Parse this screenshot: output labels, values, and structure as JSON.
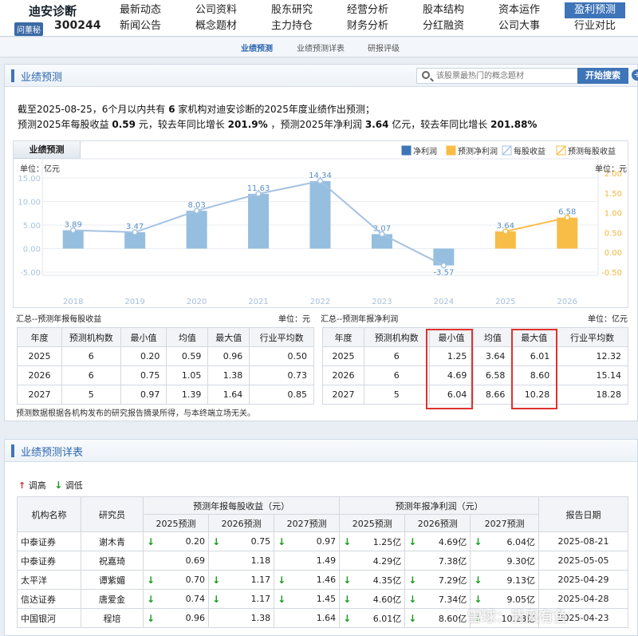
{
  "brand": {
    "name": "迪安诊断",
    "badge": "问董秘",
    "code": "300244"
  },
  "nav": [
    {
      "label": "最新动态"
    },
    {
      "label": "公司资料"
    },
    {
      "label": "股东研究"
    },
    {
      "label": "经营分析"
    },
    {
      "label": "股本结构"
    },
    {
      "label": "资本运作"
    },
    {
      "label": "盈利预测",
      "active": true
    },
    {
      "label": "新闻公告"
    },
    {
      "label": "概念题材"
    },
    {
      "label": "主力持仓"
    },
    {
      "label": "财务分析"
    },
    {
      "label": "分红融资"
    },
    {
      "label": "公司大事"
    },
    {
      "label": "行业对比"
    }
  ],
  "subnav": [
    {
      "label": "业绩预测",
      "active": true
    },
    {
      "label": "业绩预测详表"
    },
    {
      "label": "研报评级"
    }
  ],
  "panel1": {
    "title": "业绩预测",
    "search_placeholder": "该股票最热门的概念题材",
    "search_button": "开始搜索",
    "plus": "+"
  },
  "summary": {
    "line1_a": "截至2025-08-25，6个月以内共有",
    "line1_n": "6",
    "line1_b": "家机构对迪安诊断的2025年度业绩作出预测；",
    "line2_a": "预测2025年每股收益",
    "line2_eps": "0.59",
    "line2_b": "元，较去年同比增长",
    "line2_epsg": "201.9%",
    "line2_c": "，预测2025年净利润",
    "line2_np": "3.64",
    "line2_d": "亿元，较去年同比增长",
    "line2_npg": "201.88%"
  },
  "chart_tab": "业绩预测",
  "chart_data": {
    "type": "bar",
    "categories": [
      "2018",
      "2019",
      "2020",
      "2021",
      "2022",
      "2023",
      "2024",
      "2025",
      "2026"
    ],
    "left_unit": "单位：亿元",
    "right_unit": "单位：元",
    "left_ticks": [
      "15.00",
      "10.00",
      "5.00",
      "0.00",
      "-5.00"
    ],
    "right_ticks": [
      "2.00",
      "1.50",
      "1.00",
      "0.50",
      "0.00",
      "-0.50"
    ],
    "ylim_left": [
      -5,
      15
    ],
    "series": [
      {
        "name": "净利润",
        "values": [
          3.89,
          3.47,
          8.03,
          11.63,
          14.34,
          3.07,
          -3.57,
          null,
          null
        ]
      },
      {
        "name": "预测净利润",
        "values": [
          null,
          null,
          null,
          null,
          null,
          null,
          null,
          3.64,
          6.58
        ]
      }
    ],
    "value_labels": [
      "3.89",
      "3.47",
      "8.03",
      "11.63",
      "14.34",
      "3.07",
      "-3.57",
      "3.64",
      "6.58"
    ],
    "eps_lines": [
      {
        "name": "每股收益"
      },
      {
        "name": "预测每股收益"
      }
    ],
    "colors": {
      "actual": "#95bedf",
      "forecast": "#f8bd47",
      "eps_actual": "#a5c2e2",
      "eps_forecast": "#f8bd47"
    }
  },
  "left_table": {
    "caption": "汇总--预测年报每股收益",
    "unit": "单位：元",
    "headers": [
      "年度",
      "预测机构数",
      "最小值",
      "均值",
      "最大值",
      "行业平均数"
    ],
    "rows": [
      [
        "2025",
        "6",
        "0.20",
        "0.59",
        "0.96",
        "0.50"
      ],
      [
        "2026",
        "6",
        "0.75",
        "1.05",
        "1.38",
        "0.73"
      ],
      [
        "2027",
        "5",
        "0.97",
        "1.39",
        "1.64",
        "0.85"
      ]
    ]
  },
  "right_table": {
    "caption": "汇总--预测年报净利润",
    "unit": "单位：亿元",
    "headers": [
      "年度",
      "预测机构数",
      "最小值",
      "均值",
      "最大值",
      "行业平均数"
    ],
    "rows": [
      [
        "2025",
        "6",
        "1.25",
        "3.64",
        "6.01",
        "12.32"
      ],
      [
        "2026",
        "6",
        "4.69",
        "6.58",
        "8.60",
        "15.14"
      ],
      [
        "2027",
        "5",
        "6.04",
        "8.66",
        "10.28",
        "18.28"
      ]
    ]
  },
  "note": "预测数据根据各机构发布的研究报告摘录所得，与本终端立场无关。",
  "panel2": {
    "title": "业绩预测详表",
    "up_label": "调高",
    "down_label": "调低"
  },
  "detail": {
    "h_org": "机构名称",
    "h_analyst": "研究员",
    "h_eps": "预测年报每股收益（元）",
    "h_np": "预测年报净利润（元）",
    "h_date": "报告日期",
    "sub": [
      "2025预测",
      "2026预测",
      "2027预测",
      "2025预测",
      "2026预测",
      "2027预测"
    ],
    "rows": [
      {
        "org": "中泰证券",
        "analyst": "谢木青",
        "v": [
          "0.20",
          "0.75",
          "0.97",
          "1.25亿",
          "4.69亿",
          "6.04亿"
        ],
        "down": [
          true,
          true,
          true,
          true,
          true,
          true
        ],
        "date": "2025-08-21"
      },
      {
        "org": "中泰证券",
        "analyst": "祝嘉琦",
        "v": [
          "0.69",
          "1.18",
          "1.49",
          "4.29亿",
          "7.38亿",
          "9.30亿"
        ],
        "down": [
          false,
          false,
          false,
          false,
          false,
          false
        ],
        "date": "2025-05-05"
      },
      {
        "org": "太平洋",
        "analyst": "谭紫媚",
        "v": [
          "0.70",
          "1.17",
          "1.46",
          "4.35亿",
          "7.29亿",
          "9.13亿"
        ],
        "down": [
          true,
          true,
          true,
          true,
          true,
          true
        ],
        "date": "2025-04-29"
      },
      {
        "org": "信达证券",
        "analyst": "唐爱金",
        "v": [
          "0.74",
          "1.17",
          "1.45",
          "4.60亿",
          "7.34亿",
          "9.05亿"
        ],
        "down": [
          true,
          true,
          true,
          true,
          true,
          true
        ],
        "date": "2025-04-28"
      },
      {
        "org": "中国银河",
        "analyst": "程培",
        "v": [
          "0.96",
          "1.38",
          "1.64",
          "6.01亿",
          "8.60亿",
          "10.28亿"
        ],
        "down": [
          true,
          false,
          false,
          true,
          true,
          true
        ],
        "date": "2025-04-23"
      }
    ]
  },
  "watermark": "雪球：清风有鱼"
}
